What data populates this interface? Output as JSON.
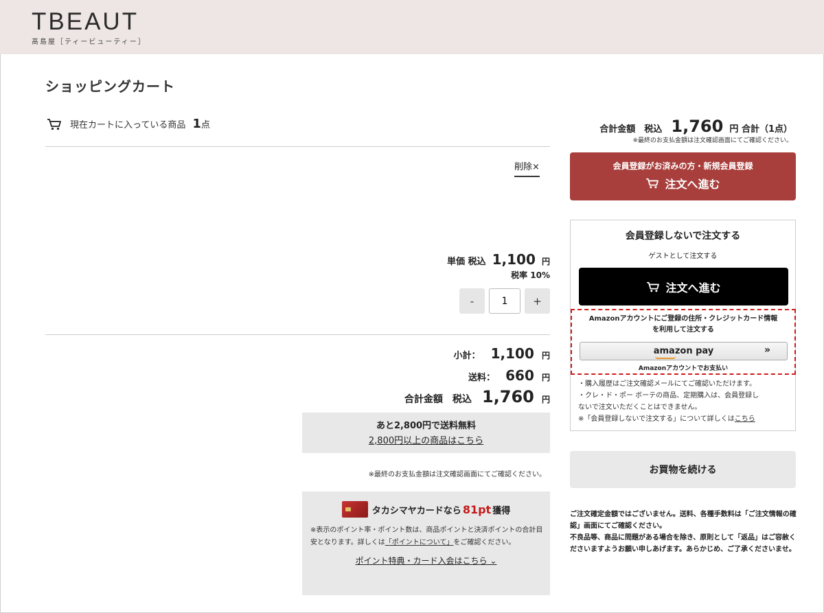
{
  "header": {
    "logo_main": "TBEAUT",
    "logo_sub": "髙島屋［ティービューティー］"
  },
  "page": {
    "title": "ショッピングカート"
  },
  "cart": {
    "count_label": "現在カートに入っている商品",
    "count": "1",
    "count_unit": "点",
    "delete_label": "削除×"
  },
  "item": {
    "unit_price_label": "単価 税込",
    "unit_price": "1,100",
    "yen": "円",
    "tax_rate": "税率 10%",
    "quantity": "1",
    "minus": "-",
    "plus": "+"
  },
  "summary": {
    "subtotal_label": "小計：",
    "subtotal": "1,100",
    "shipping_label": "送料：",
    "shipping": "660",
    "total_label": "合計金額　税込",
    "total": "1,760",
    "yen": "円",
    "free_ship_line": "あと2,800円で送料無料",
    "free_ship_link": "2,800円以上の商品はこちら",
    "final_note": "※最終のお支払金額は注文確認画面にてご確認ください。"
  },
  "points": {
    "headline_pre": "タカシマヤカードなら",
    "points": "81pt",
    "headline_post": "獲得",
    "desc_1": "※表示のポイント率・ポイント数は、商品ポイントと決済ポイントの合計目安となります。詳しくは",
    "desc_link": "「ポイントについて」",
    "desc_2": "をご確認ください。",
    "more_link": "ポイント特典・カード入会はこちら"
  },
  "side": {
    "total_label": "合計金額　税込",
    "total": "1,760",
    "total_suffix": "円 合計（1点）",
    "note": "※最終のお支払金額は注文確認画面にてご確認ください。",
    "member_line1": "会員登録がお済みの方・新規会員登録",
    "member_line2": "注文へ進む",
    "guest_title": "会員登録しないで注文する",
    "guest_sub": "ゲストとして注文する",
    "guest_button": "注文へ進む",
    "amazon_line1": "Amazonアカウントにご登録の住所・クレジットカード情報",
    "amazon_line2": "を利用して注文する",
    "amazon_pay": "amazon pay",
    "amazon_chevron": "»",
    "amazon_caption": "Amazonアカウントでお支払い",
    "guest_note_1": "・購入履歴はご注文確認メールにてご確認いただけます。",
    "guest_note_2": "・クレ・ド・ポー ボーテの商品、定期購入は、会員登録し",
    "guest_note_3": "ないで注文いただくことはできません。",
    "guest_note_4": "※「会員登録しないで注文する」について詳しくは",
    "guest_note_link": "こちら",
    "continue_button": "お買物を続ける",
    "bottom_note_1": "ご注文確定金額ではございません。送料、各種手数料は「ご注文情報の確認」画面にてご確認ください。",
    "bottom_note_2": "不良品等、商品に問題がある場合を除き、原則として「返品」はご容赦くださいますようお願い申しあげます。あらかじめ、ご了承くださいませ。"
  },
  "colors": {
    "header_bg": "#ede6e4",
    "member_button": "#a83f3c",
    "guest_button": "#000000",
    "points_accent": "#c41b1b",
    "amazon_border": "#d01818"
  }
}
